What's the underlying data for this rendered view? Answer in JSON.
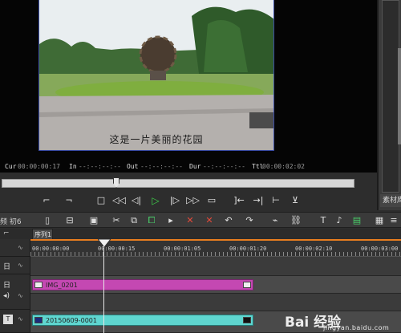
{
  "preview": {
    "subtitle": "这是一片美丽的花园",
    "timecodes": {
      "cur_label": "Cur",
      "cur_value": "00:00:00:17",
      "in_label": "In",
      "in_value": "--:--:--:--",
      "out_label": "Out",
      "out_value": "--:--:--:--",
      "dur_label": "Dur",
      "dur_value": "--:--:--:--",
      "ttl_label": "Ttl",
      "ttl_value": "00:00:02:02"
    }
  },
  "right_panel": {
    "tab_label": "素材库"
  },
  "transport": {
    "buttons": [
      "set-in",
      "set-out",
      "stop",
      "rewind",
      "step-back",
      "play",
      "step-forward",
      "fast-forward",
      "loop",
      "match-frame-in",
      "match-frame-out",
      "trim",
      "add-marker"
    ]
  },
  "toolbar": {
    "left_labels": "频  初6",
    "items": [
      "new",
      "open",
      "save",
      "cut",
      "copy",
      "paste",
      "delete-left",
      "delete-right",
      "undo",
      "redo",
      "ripple",
      "link",
      "text",
      "audio",
      "render",
      "expand"
    ]
  },
  "sequence": {
    "tab_label": "序列1"
  },
  "ruler": {
    "labels": [
      "00:00:00:00",
      "00:00:00:15",
      "00:00:01:05",
      "00:00:01:20",
      "00:00:02:10",
      "00:00:03:00"
    ]
  },
  "tracks": {
    "headers": [
      {
        "label": "日"
      },
      {
        "label": "日"
      },
      {
        "label": "T"
      }
    ],
    "clips": [
      {
        "name": "IMG_0201",
        "color": "#c448b2"
      },
      {
        "name": "20150609-0001",
        "color": "#5fd6d0"
      }
    ]
  },
  "watermark": {
    "text": "Bai 经验",
    "sub": "jingyan.baidu.com"
  }
}
